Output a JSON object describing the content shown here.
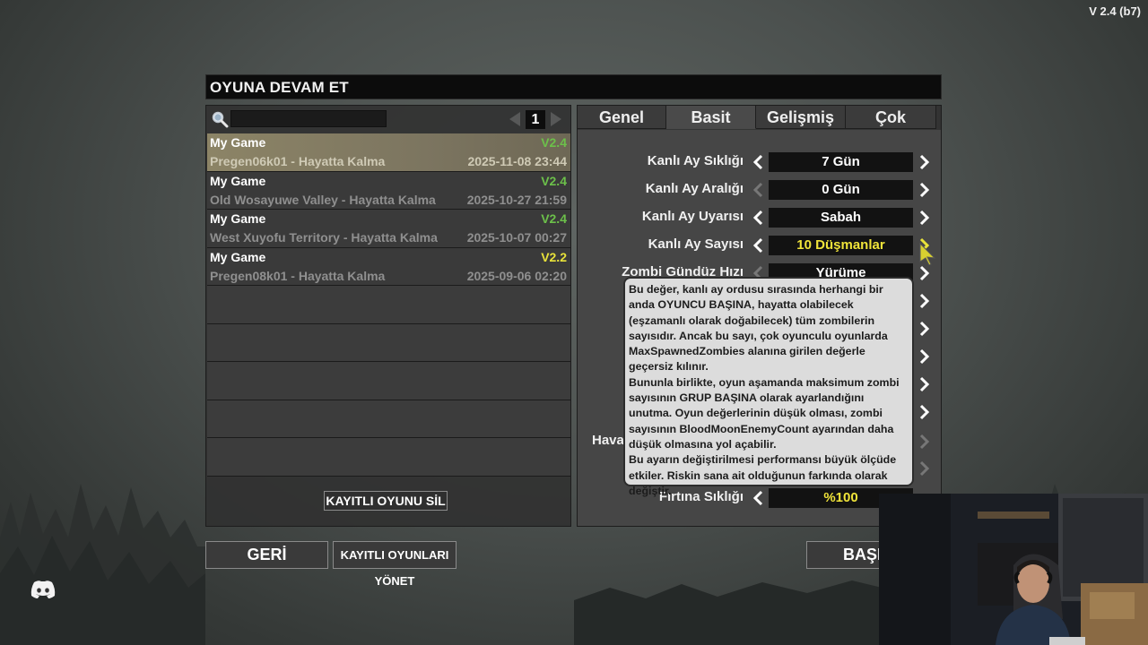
{
  "version": "V 2.4 (b7)",
  "title": "OYUNA DEVAM ET",
  "search": {
    "value": "",
    "placeholder": ""
  },
  "pager": {
    "page": "1"
  },
  "saves": [
    {
      "name": "My Game",
      "version": "V2.4",
      "world": "Pregen06k01 - Hayatta Kalma",
      "date": "2025-11-08 23:44",
      "selected": true
    },
    {
      "name": "My Game",
      "version": "V2.4",
      "world": "Old Wosayuwe Valley - Hayatta Kalma",
      "date": "2025-10-27 21:59"
    },
    {
      "name": "My Game",
      "version": "V2.4",
      "world": "West Xuyofu Territory - Hayatta Kalma",
      "date": "2025-10-07 00:27"
    },
    {
      "name": "My Game",
      "version": "V2.2",
      "world": "Pregen08k01 - Hayatta Kalma",
      "date": "2025-09-06 02:20"
    }
  ],
  "delete_button": "KAYITLI OYUNU SİL",
  "tabs": [
    "Genel",
    "Basit",
    "Gelişmiş",
    "Çok Oyunculu"
  ],
  "active_tab": "Basit",
  "settings": [
    {
      "label": "Kanlı Ay Sıklığı",
      "value": "7 Gün"
    },
    {
      "label": "Kanlı Ay Aralığı",
      "value": "0 Gün"
    },
    {
      "label": "Kanlı Ay Uyarısı",
      "value": "Sabah"
    },
    {
      "label": "Kanlı Ay Sayısı",
      "value": "10 Düşmanlar"
    },
    {
      "label": "Zombi Gündüz Hızı",
      "value": "Yürüme"
    },
    {
      "label": "Hava",
      "value": ""
    },
    {
      "label": "Fırtına Sıklığı",
      "value": "%100"
    }
  ],
  "tooltip": [
    "Bu değer, kanlı ay ordusu sırasında herhangi bir anda OYUNCU BAŞINA, hayatta olabilecek (eşzamanlı olarak doğabilecek) tüm zombilerin sayısıdır. Ancak bu sayı, çok oyunculu oyunlarda MaxSpawnedZombies alanına girilen değerle geçersiz kılınır.",
    "Bununla birlikte, oyun aşamanda maksimum zombi sayısının GRUP BAŞINA olarak ayarlandığını unutma. Oyun değerlerinin düşük olması, zombi sayısının BloodMoonEnemyCount ayarından daha düşük olmasına yol açabilir.",
    "Bu ayarın değiştirilmesi performansı büyük ölçüde etkiler. Riskin sana ait olduğunun farkında olarak değiştir."
  ],
  "buttons": {
    "back": "GERİ",
    "manage": "KAYITLI OYUNLARI YÖNET",
    "start": "BAŞL"
  },
  "colors": {
    "version_current": "#6cc04a",
    "version_old": "#e8e23a",
    "highlight_value": "#f0e43a",
    "selected_row": "#8c8466"
  },
  "icons": [
    "search-icon",
    "chevron-left-icon",
    "chevron-right-icon",
    "discord-icon",
    "mouse-cursor-icon"
  ]
}
